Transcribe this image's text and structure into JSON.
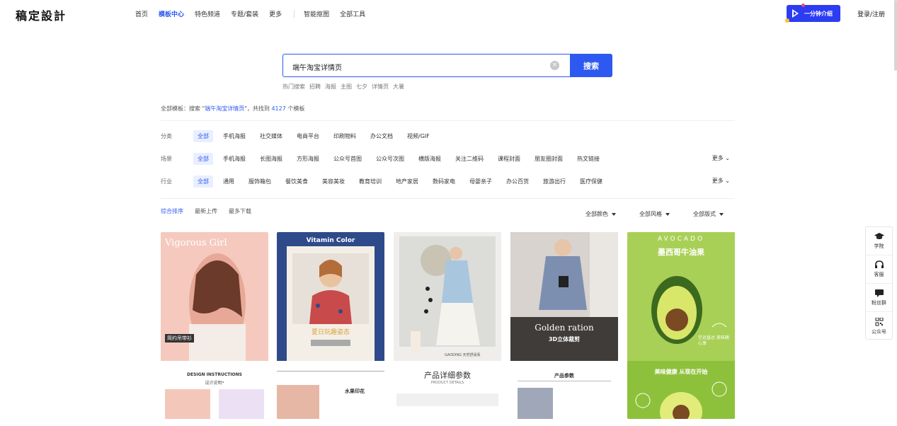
{
  "app": {
    "logo": "稿定設計"
  },
  "nav": {
    "items": [
      {
        "label": "首页"
      },
      {
        "label": "模板中心",
        "active": true
      },
      {
        "label": "特色频道"
      },
      {
        "label": "专题/套装"
      },
      {
        "label": "更多"
      }
    ],
    "tools": [
      {
        "label": "智能抠图"
      },
      {
        "label": "全部工具"
      }
    ]
  },
  "header": {
    "promo_label": "一分钟介绍",
    "login_label": "登录/注册",
    "accent": "#2e59f0"
  },
  "search": {
    "value": "端午淘宝详情页",
    "button_label": "搜索",
    "hot_label": "热门搜索",
    "hot_terms": [
      "招聘",
      "海报",
      "主图",
      "七夕",
      "详情页",
      "大暑"
    ]
  },
  "result": {
    "scope": "全部模板",
    "prefix": "：搜索 \"",
    "keyword": "端午淘宝详情页",
    "mid": "\"，共找到",
    "count": "4127",
    "suffix": "个模板"
  },
  "filters": {
    "category": {
      "label": "分类",
      "options": [
        "全部",
        "手机海报",
        "社交媒体",
        "电商平台",
        "印刷物料",
        "办公文档",
        "视频/GIF"
      ]
    },
    "scene": {
      "label": "场景",
      "options": [
        "全部",
        "手机海报",
        "长图海报",
        "方形海报",
        "公众号首图",
        "公众号次图",
        "横版海报",
        "关注二维码",
        "课程封面",
        "朋友圈封面",
        "热文链接"
      ],
      "more": "更多"
    },
    "industry": {
      "label": "行业",
      "options": [
        "全部",
        "通用",
        "服饰箱包",
        "餐饮美食",
        "美容美妆",
        "教育培训",
        "地产家居",
        "数码家电",
        "母婴亲子",
        "办公百货",
        "旅游出行",
        "医疗保健"
      ],
      "more": "更多"
    }
  },
  "sort": {
    "tabs": [
      "综合排序",
      "最新上传",
      "最多下载"
    ],
    "dropdowns": [
      "全部颜色",
      "全部风格",
      "全部版式"
    ]
  },
  "cards": [
    {
      "title": "Vigorous Girl",
      "subtitle": "简约吊带衫",
      "sub2": "DESIGN INSTRUCTIONS",
      "sub3": "设计说明*",
      "color": "#f5c9be"
    },
    {
      "title": "Vitamin Color",
      "subtitle": "夏日玩趣姿态",
      "sub2": "水果印花",
      "color": "#efe9e2"
    },
    {
      "title": "GAODING 天然舒适系",
      "subtitle": "产品详细参数",
      "sub2": "PRODUCT DETAILS",
      "color": "#e7e7e5"
    },
    {
      "title": "Golden ration",
      "subtitle": "3D立体裁剪",
      "sub2": "产品参数",
      "color": "#4a4744"
    },
    {
      "title": "AVOCADO",
      "subtitle": "墨西哥牛油果",
      "sub2": "美味健康 从现在开始",
      "sub3": "空运直达 美味随心享",
      "color": "#a7cf53"
    }
  ],
  "float_panel": {
    "items": [
      {
        "label": "学院",
        "icon": "graduation-cap-icon"
      },
      {
        "label": "客服",
        "icon": "headset-icon"
      },
      {
        "label": "粉丝群",
        "icon": "chat-bubble-icon"
      },
      {
        "label": "公众号",
        "icon": "qrcode-icon"
      }
    ]
  }
}
